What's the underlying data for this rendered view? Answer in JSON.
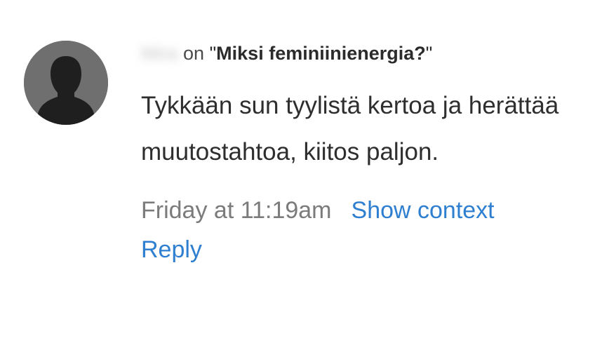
{
  "comment": {
    "author": "Mira",
    "on_word": "on",
    "title_open_quote": "\"",
    "post_title": "Miksi feminiinienergia?",
    "title_close_quote": "\"",
    "text": "Tykkään sun tyylistä kertoa ja herättää muutostahtoa, kiitos paljon.",
    "timestamp": "Friday at 11:19am",
    "show_context_label": "Show context",
    "reply_label": "Reply"
  },
  "colors": {
    "link": "#2f7fd0",
    "avatar_bg": "#6f6f6f",
    "avatar_silhouette": "#1f1f1f"
  },
  "icons": {
    "avatar": "default-person-silhouette-icon"
  }
}
